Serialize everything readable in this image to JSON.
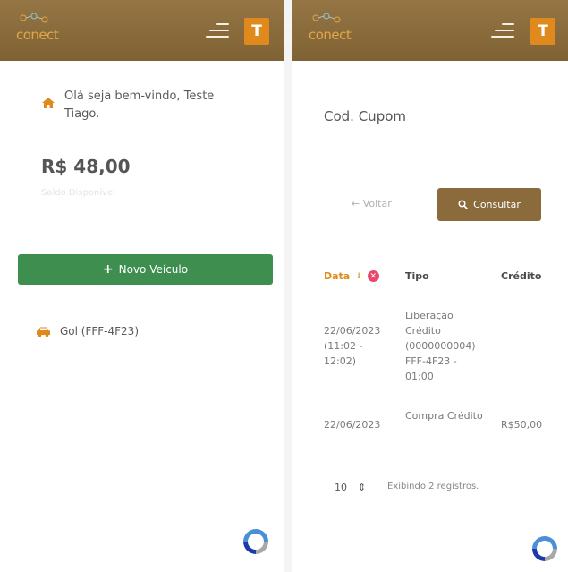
{
  "left_panel": {
    "header": {
      "logo_text": "conect",
      "avatar_initial": "T"
    },
    "welcome_text": "Olá seja bem-vindo, Teste Tiago.",
    "balance": "R$ 48,00",
    "faded_text": "Saldo Disponível",
    "new_vehicle_button": {
      "icon": "+",
      "label": "Novo Veículo"
    },
    "vehicle": {
      "label": "Gol (FFF-4F23)"
    }
  },
  "right_panel": {
    "header": {
      "logo_text": "conect",
      "avatar_initial": "T"
    },
    "coupon_title": "Cod. Cupom",
    "back_button": "← Voltar",
    "consult_button": "Consultar",
    "table": {
      "columns": {
        "date": "Data",
        "sort_indicator": "↓",
        "clear_icon": "✕",
        "type": "Tipo",
        "credit": "Crédito"
      },
      "rows": [
        {
          "date": "22/06/2023 (11:02 - 12:02)",
          "type": "Liberação Crédito (0000000004) FFF-4F23 - 01:00",
          "credit": ""
        },
        {
          "date": "22/06/2023",
          "type": "Compra Crédito",
          "credit": "R$50,00"
        }
      ]
    },
    "pagination": {
      "page_size": "10",
      "select_arrow": "⇕",
      "info": "Exibindo 2 registros."
    }
  },
  "colors": {
    "header_brown": "#8b6b3c",
    "avatar_orange": "#e08a1e",
    "new_button_green": "#3e8f4f",
    "date_header_orange": "#e08a1e",
    "clear_pink": "#e8496b"
  },
  "icons": {
    "menu": "hamburger-menu-icon",
    "home": "home-icon",
    "car": "car-icon",
    "search": "search-icon",
    "recaptcha": "recaptcha-icon"
  }
}
